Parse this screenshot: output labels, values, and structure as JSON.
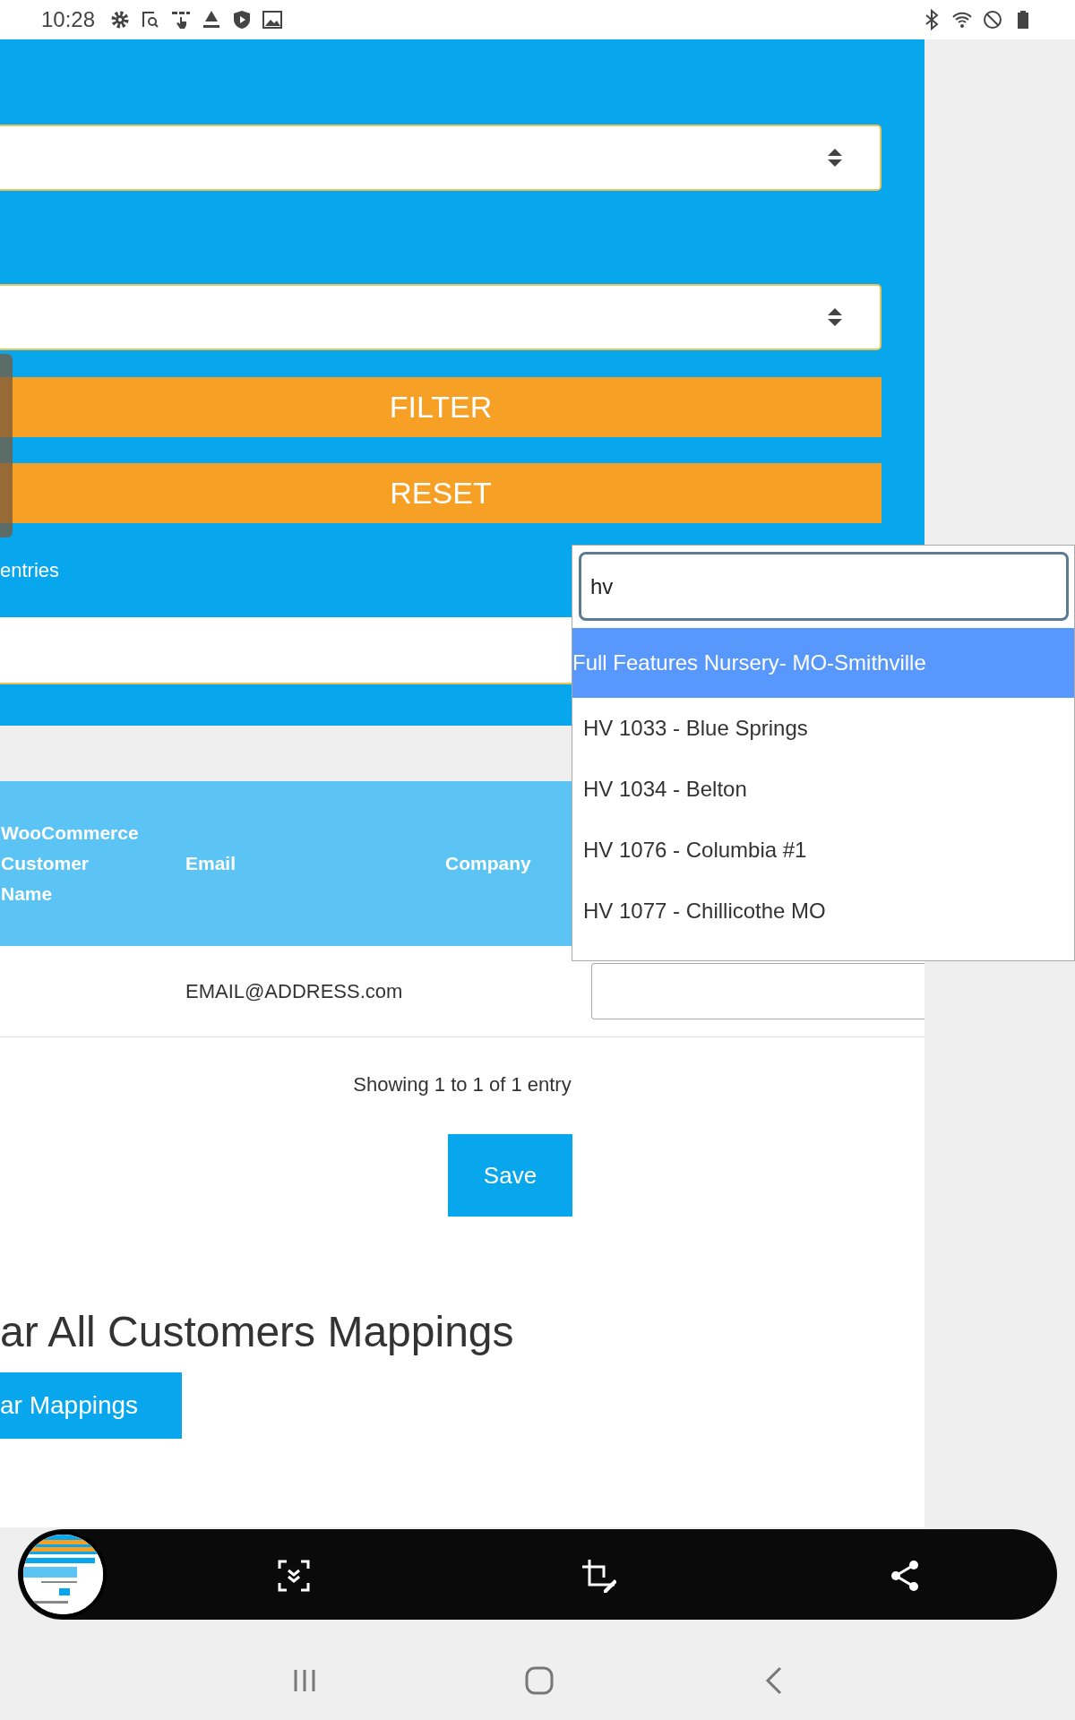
{
  "status_bar": {
    "time": "10:28"
  },
  "filter_panel": {
    "buttons": [
      {
        "label": "FILTER"
      },
      {
        "label": "RESET"
      }
    ],
    "entries_label": "entries"
  },
  "table": {
    "columns": [
      "WooCommerce Customer Name",
      "Email",
      "Company"
    ],
    "rows": [
      {
        "email": "EMAIL@ADDRESS.com"
      }
    ]
  },
  "info": "Showing 1 to 1 of 1 entry",
  "save_button": "Save",
  "clear_section": {
    "heading": "ar All Customers Mappings",
    "button": "ar Mappings"
  },
  "dropdown": {
    "search_value": "hv",
    "options": [
      {
        "label": "Full Features Nursery- MO-Smithville",
        "selected": true
      },
      {
        "label": "HV 1033 - Blue Springs",
        "selected": false
      },
      {
        "label": "HV 1034 - Belton",
        "selected": false
      },
      {
        "label": "HV 1076 - Columbia #1",
        "selected": false
      },
      {
        "label": "HV 1077 - Chillicothe MO",
        "selected": false
      }
    ]
  }
}
